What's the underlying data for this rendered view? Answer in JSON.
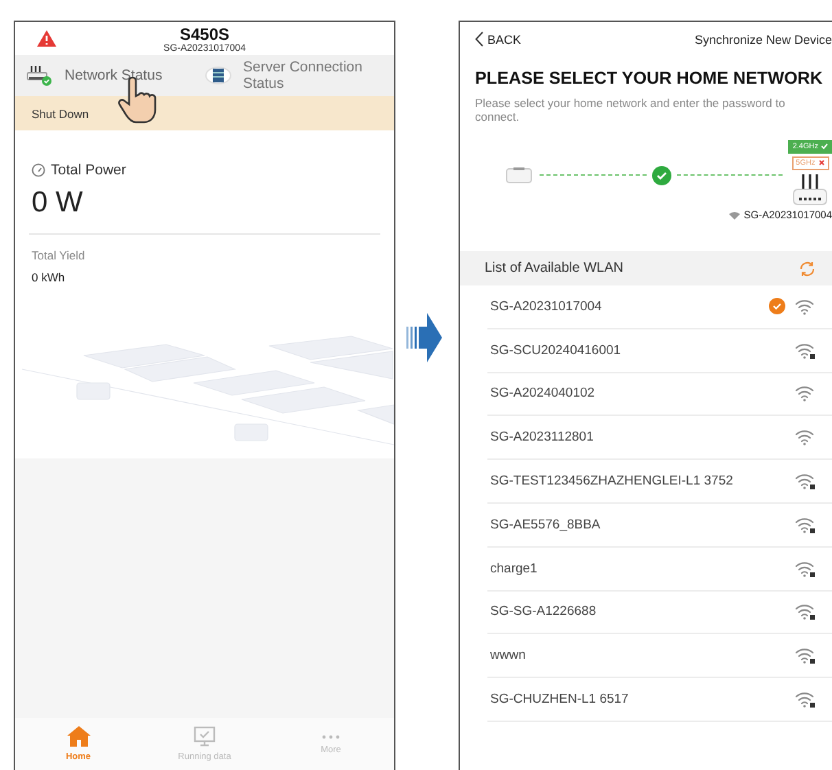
{
  "home_screen": {
    "device": {
      "name": "S450S",
      "serial": "SG-A20231017004"
    },
    "status_tabs": [
      {
        "kind": "network",
        "label": "Network Status",
        "selected": true
      },
      {
        "kind": "server",
        "label": "Server Connection Status",
        "selected": false
      }
    ],
    "banner": "Shut Down",
    "power": {
      "label": "Total Power",
      "value": "0 W"
    },
    "yield": {
      "label": "Total Yield",
      "value": "0 kWh"
    },
    "bottom_tabs": [
      {
        "kind": "home",
        "label": "Home",
        "selected": true
      },
      {
        "kind": "monitor",
        "label": "Running data",
        "selected": false
      },
      {
        "kind": "more",
        "label": "More",
        "selected": false
      }
    ]
  },
  "wlan_screen": {
    "back": "BACK",
    "header": "Synchronize New Device",
    "title": "PLEASE SELECT YOUR HOME NETWORK",
    "description": "Please select your home network and enter the password to connect.",
    "bands": [
      {
        "label": "2.4GHz",
        "ok": true
      },
      {
        "label": "5GHz",
        "ok": false
      }
    ],
    "connected_network": "SG-A20231017004",
    "list_title": "List of Available WLAN",
    "networks": [
      {
        "name": "SG-A20231017004",
        "selected": true,
        "locked": false
      },
      {
        "name": "SG-SCU20240416001",
        "selected": false,
        "locked": true
      },
      {
        "name": "SG-A2024040102",
        "selected": false,
        "locked": false
      },
      {
        "name": "SG-A2023112801",
        "selected": false,
        "locked": false
      },
      {
        "name": "SG-TEST123456ZHAZHENGLEI-L1 3752",
        "selected": false,
        "locked": true
      },
      {
        "name": "SG-AE5576_8BBA",
        "selected": false,
        "locked": true
      },
      {
        "name": "charge1",
        "selected": false,
        "locked": true
      },
      {
        "name": "SG-SG-A1226688",
        "selected": false,
        "locked": true
      },
      {
        "name": "wwwn",
        "selected": false,
        "locked": true
      },
      {
        "name": "SG-CHUZHEN-L1 6517",
        "selected": false,
        "locked": true
      }
    ]
  }
}
